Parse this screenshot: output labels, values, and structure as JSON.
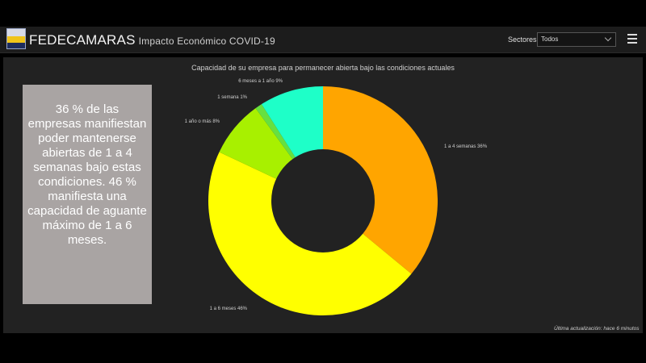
{
  "header": {
    "title": "FEDECAMARAS",
    "subtitle": "Impacto Económico COVID-19",
    "sectores_label": "Sectores",
    "sectores_value": "Todos"
  },
  "summary_text": "36 % de las empresas manifiestan poder mantenerse abiertas de 1 a 4 semanas bajo estas condiciones. 46 % manifiesta una capacidad de aguante máximo de 1 a 6 meses.",
  "footer_note": "Última actualización: hace 6 minutos",
  "chart_data": {
    "type": "pie",
    "title": "Capacidad de su empresa para permanecer abierta bajo las condiciones actuales",
    "slices": [
      {
        "label": "1 a 4 semanas 36%",
        "value": 36,
        "color": "#ffa500"
      },
      {
        "label": "1 a 6 meses 46%",
        "value": 46,
        "color": "#ffff00"
      },
      {
        "label": "1 año o más 8%",
        "value": 8,
        "color": "#a8f000"
      },
      {
        "label": "1 semana 1%",
        "value": 1,
        "color": "#66e040"
      },
      {
        "label": "6 meses a 1 año 9%",
        "value": 9,
        "color": "#1effc8"
      }
    ],
    "donut": true,
    "legend": "none"
  }
}
